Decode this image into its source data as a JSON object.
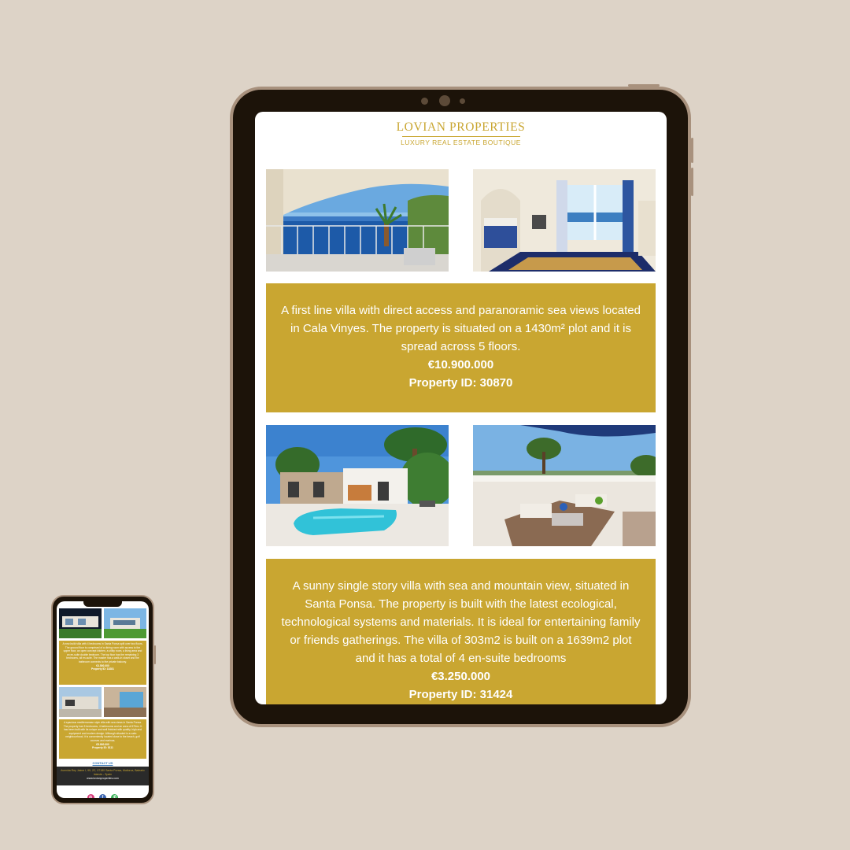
{
  "brand": {
    "name": "LOVIAN PROPERTIES",
    "tagline": "LUXURY REAL ESTATE BOUTIQUE"
  },
  "colors": {
    "background": "#ddd3c7",
    "device_frame": "#1c1309",
    "device_bezel": "#a8917d",
    "accent_gold": "#c9a631",
    "text_on_accent": "#ffffff"
  },
  "listings": [
    {
      "description": "A first line villa with direct access and paranoramic sea views located in Cala Vinyes. The property is situated on a 1430m² plot and it is spread across 5 floors.",
      "price": "€10.900.000",
      "property_id": "Property ID: 30870",
      "photos": [
        "sea-view-terrace-photo",
        "bedroom-photo"
      ]
    },
    {
      "description": "A sunny single story villa with sea and mountain view, situated in Santa Ponsa. The property is built with the latest ecological, technological systems and materials. It is ideal for entertaining family or friends gatherings. The villa of 303m2 is built on a 1639m2 plot and it has a total of 4 en-suite bedrooms",
      "price": "€3.250.000",
      "property_id": "Property ID: 31424",
      "photos": [
        "pool-villa-photo",
        "rooftop-terrace-photo"
      ]
    }
  ],
  "mobile": {
    "listings": [
      {
        "description": "A new-build villa with 4 bedrooms in Santa Ponsa split over two floors. The ground floor is comprised of a dining room with access to the upper floor, an open concept kitchen, a utility room, a living area and an en-suite double bedroom. The top floor has the remaining 3 bedrooms, all en-suite. The master has a walk-in closet and the bathroom connects to the private balcony.",
        "price": "€3.500.000",
        "property_id": "Property ID: 18281"
      },
      {
        "description": "A spacious mediterranean style villa with sea views in Santa Ponsa. The property has 5 bedrooms, 4 bathrooms and an area of 876m². It has been built with its unique and well finished with quality, high-end equipment and modern design. Although situated in a calm neighbourhood, it is conveniently located close to the beach, golf courses and marinas.",
        "price": "€5.900.000",
        "property_id": "Property ID: 8111"
      }
    ],
    "contact_label": "CONTACT US",
    "footer_address": "Avenida Rey Jaime I, 99, 2C, 07180 Santa Ponsa, Mallorca, Balearic Islands - Spain",
    "footer_web": "www.lovianproperties.com",
    "social_icons": [
      "instagram-icon",
      "facebook-icon",
      "whatsapp-icon"
    ]
  }
}
